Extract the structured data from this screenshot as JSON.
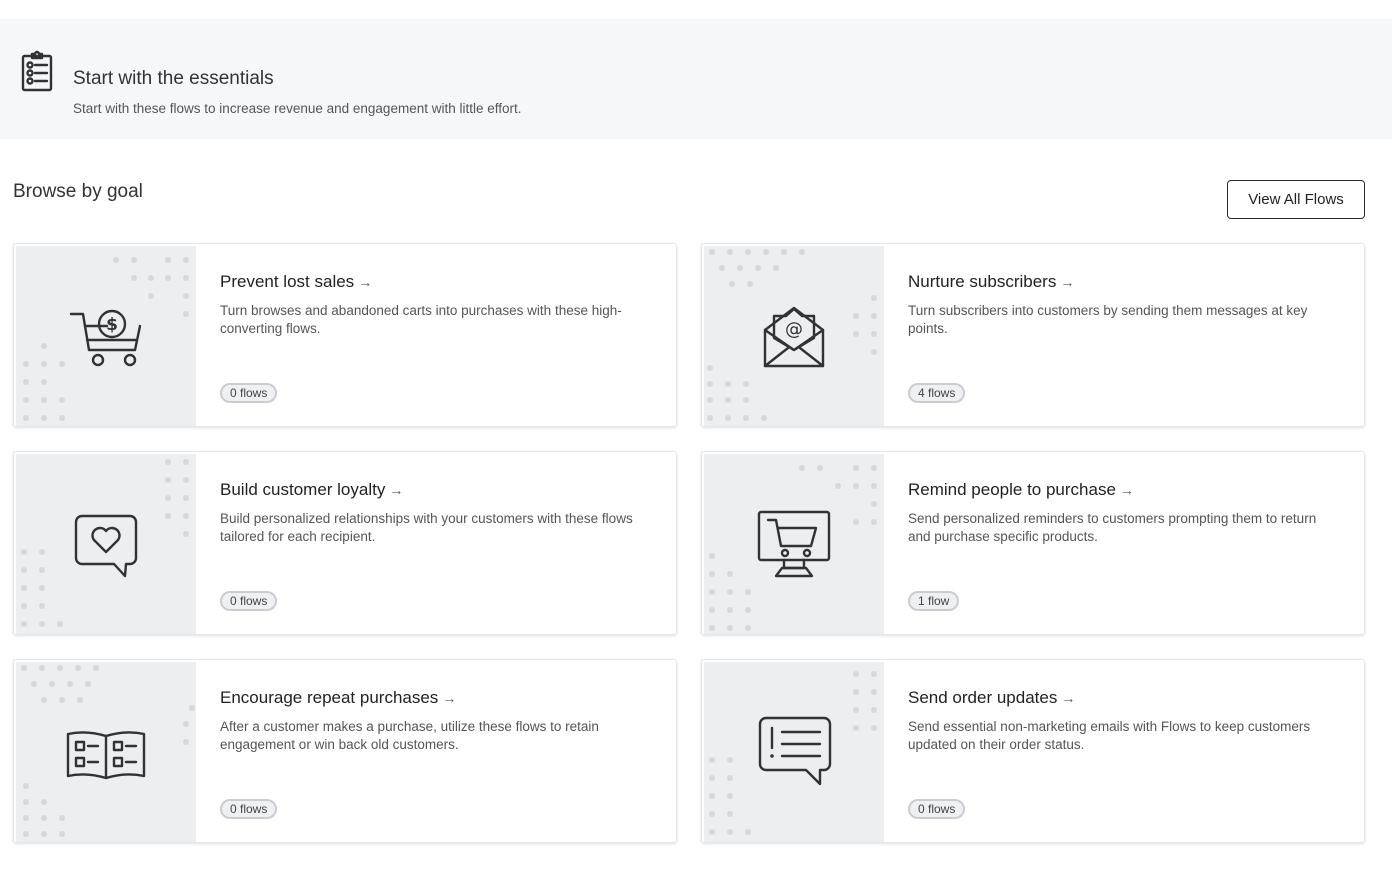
{
  "essentials": {
    "title": "Start with the essentials",
    "subtitle": "Start with these flows to increase revenue and engagement with little effort.",
    "icon": "clipboard-list-icon"
  },
  "browse": {
    "title": "Browse by goal",
    "view_all_label": "View All Flows"
  },
  "goals": [
    {
      "title": "Prevent lost sales",
      "arrow": "→",
      "description": "Turn browses and abandoned carts into purchases with these high-converting flows.",
      "badge": "0 flows",
      "icon": "shopping-cart-dollar-icon"
    },
    {
      "title": "Nurture subscribers",
      "arrow": "→",
      "description": "Turn subscribers into customers by sending them messages at key points.",
      "badge": "4 flows",
      "icon": "email-envelope-icon"
    },
    {
      "title": "Build customer loyalty",
      "arrow": "→",
      "description": "Build personalized relationships with your customers with these flows tailored for each recipient.",
      "badge": "0 flows",
      "icon": "heart-speech-bubble-icon"
    },
    {
      "title": "Remind people to purchase",
      "arrow": "→",
      "description": "Send personalized reminders to customers prompting them to return and purchase specific products.",
      "badge": "1 flow",
      "icon": "monitor-cart-icon"
    },
    {
      "title": "Encourage repeat purchases",
      "arrow": "→",
      "description": "After a customer makes a purchase, utilize these flows to retain engagement or win back old customers.",
      "badge": "0 flows",
      "icon": "open-catalog-icon"
    },
    {
      "title": "Send order updates",
      "arrow": "→",
      "description": "Send essential non-marketing emails with Flows to keep customers updated on their order status.",
      "badge": "0 flows",
      "icon": "alert-message-bubble-icon"
    }
  ],
  "colors": {
    "banner_background": "#f6f7f8",
    "card_art_background": "#eceeef",
    "badge_border": "#c9cdd1",
    "icon_stroke": "#2f3336"
  }
}
